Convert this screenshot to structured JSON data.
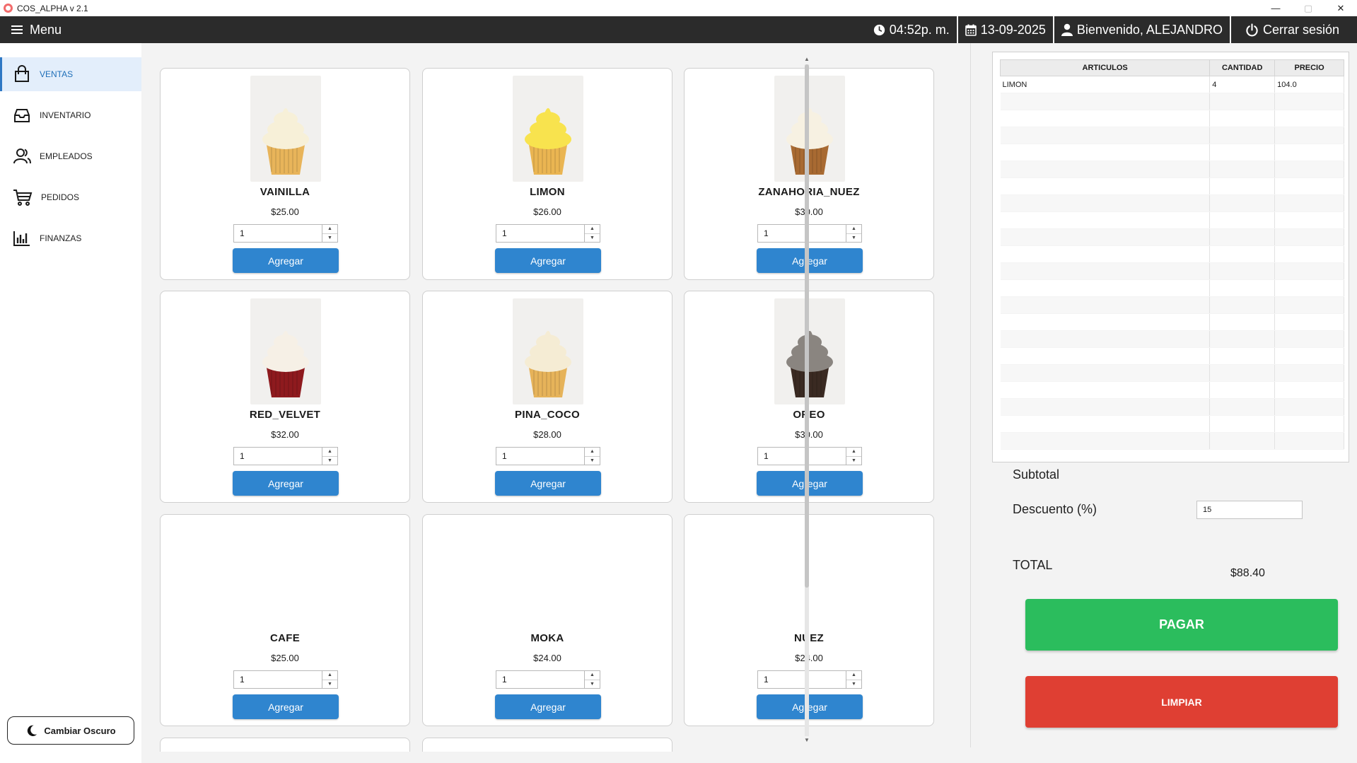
{
  "window": {
    "title": "COS_ALPHA v 2.1",
    "minimize": "—",
    "maximize": "▢",
    "close": "✕"
  },
  "topbar": {
    "menu_label": "Menu",
    "time": "04:52p. m.",
    "date": "13-09-2025",
    "welcome": "Bienvenido, ALEJANDRO",
    "logout": "Cerrar sesión"
  },
  "sidebar": {
    "items": [
      {
        "label": "VENTAS",
        "icon": "shopping-bag-icon",
        "active": true
      },
      {
        "label": "INVENTARIO",
        "icon": "inbox-icon",
        "active": false
      },
      {
        "label": "EMPLEADOS",
        "icon": "users-icon",
        "active": false
      },
      {
        "label": "PEDIDOS",
        "icon": "cart-icon",
        "active": false
      },
      {
        "label": "FINANZAS",
        "icon": "bar-chart-icon",
        "active": false
      }
    ],
    "dark_mode_label": "Cambiar Oscuro"
  },
  "products": [
    {
      "name": "VAINILLA",
      "price": "$25.00",
      "qty": "1",
      "button": "Agregar",
      "frosting": "#f7f0d8",
      "cake": "#e8b45a"
    },
    {
      "name": "LIMON",
      "price": "$26.00",
      "qty": "1",
      "button": "Agregar",
      "frosting": "#f8e34e",
      "cake": "#eab552"
    },
    {
      "name": "ZANAHORIA_NUEZ",
      "price": "$30.00",
      "qty": "1",
      "button": "Agregar",
      "frosting": "#f7f1e2",
      "cake": "#a86a32"
    },
    {
      "name": "RED_VELVET",
      "price": "$32.00",
      "qty": "1",
      "button": "Agregar",
      "frosting": "#f6f0e6",
      "cake": "#8e1a1e"
    },
    {
      "name": "PINA_COCO",
      "price": "$28.00",
      "qty": "1",
      "button": "Agregar",
      "frosting": "#f5ecd4",
      "cake": "#e6b35a"
    },
    {
      "name": "OREO",
      "price": "$30.00",
      "qty": "1",
      "button": "Agregar",
      "frosting": "#8a8580",
      "cake": "#3a2a22"
    },
    {
      "name": "CAFE",
      "price": "$25.00",
      "qty": "1",
      "button": "Agregar",
      "frosting": "",
      "cake": ""
    },
    {
      "name": "MOKA",
      "price": "$24.00",
      "qty": "1",
      "button": "Agregar",
      "frosting": "",
      "cake": ""
    },
    {
      "name": "NUEZ",
      "price": "$24.00",
      "qty": "1",
      "button": "Agregar",
      "frosting": "",
      "cake": ""
    }
  ],
  "cart": {
    "columns": [
      "ARTICULOS",
      "CANTIDAD",
      "PRECIO"
    ],
    "rows": [
      [
        "LIMON",
        "4",
        "104.0"
      ]
    ]
  },
  "summary": {
    "subtotal_label": "Subtotal",
    "discount_label": "Descuento (%)",
    "discount_value": "15",
    "total_label": "TOTAL",
    "total_value": "$88.40",
    "pay_label": "PAGAR",
    "clear_label": "LIMPIAR"
  },
  "colors": {
    "topbar": "#2b2b2b",
    "accent_blue": "#2f85cf",
    "pay_green": "#2bbd5d",
    "clear_red": "#df3f33"
  }
}
